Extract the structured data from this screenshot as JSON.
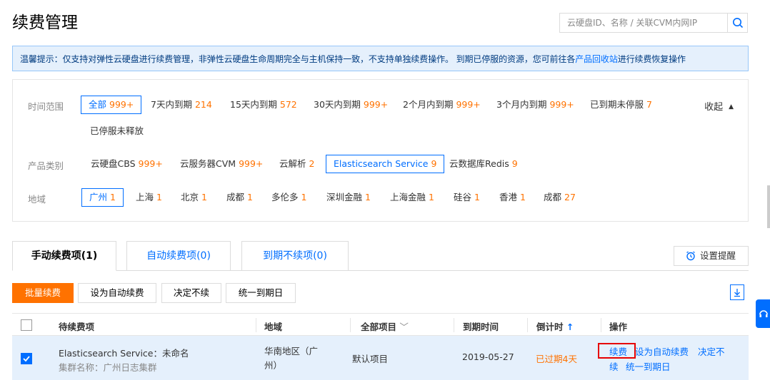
{
  "header": {
    "title": "续费管理",
    "search_placeholder": "云硬盘ID、名称 / 关联CVM内网IP"
  },
  "tip": {
    "text_before": "温馨提示：仅支持对弹性云硬盘进行续费管理，非弹性云硬盘生命周期完全与主机保持一致，不支持单独续费操作。 到期已停服的资源，您可前往各",
    "link": "产品回收站",
    "text_after": "进行续费恢复操作"
  },
  "filters": {
    "time": {
      "label": "时间范围",
      "items": [
        {
          "name": "全部",
          "count": "999+",
          "selected": true
        },
        {
          "name": "7天内到期",
          "count": "214"
        },
        {
          "name": "15天内到期",
          "count": "572"
        },
        {
          "name": "30天内到期",
          "count": "999+"
        },
        {
          "name": "2个月内到期",
          "count": "999+"
        },
        {
          "name": "3个月内到期",
          "count": "999+"
        },
        {
          "name": "已到期未停服",
          "count": "7"
        },
        {
          "name": "已停服未释放",
          "count": ""
        }
      ]
    },
    "collapse_label": "收起",
    "product": {
      "label": "产品类别",
      "items": [
        {
          "name": "云硬盘CBS",
          "count": "999+"
        },
        {
          "name": "云服务器CVM",
          "count": "999+"
        },
        {
          "name": "云解析",
          "count": "2"
        },
        {
          "name": "Elasticsearch Service",
          "count": "9",
          "selected": true
        },
        {
          "name": "云数据库Redis",
          "count": "9"
        }
      ]
    },
    "region": {
      "label": "地域",
      "items": [
        {
          "name": "广州",
          "count": "1",
          "selected": true
        },
        {
          "name": "上海",
          "count": "1"
        },
        {
          "name": "北京",
          "count": "1"
        },
        {
          "name": "成都",
          "count": "1"
        },
        {
          "name": "多伦多",
          "count": "1"
        },
        {
          "name": "深圳金融",
          "count": "1"
        },
        {
          "name": "上海金融",
          "count": "1"
        },
        {
          "name": "硅谷",
          "count": "1"
        },
        {
          "name": "香港",
          "count": "1"
        },
        {
          "name": "成都",
          "count": "27"
        }
      ]
    }
  },
  "tabs": [
    {
      "label": "手动续费项(1)",
      "active": true
    },
    {
      "label": "自动续费项(0)"
    },
    {
      "label": "到期不续项(0)"
    }
  ],
  "remind_label": "设置提醒",
  "actions": {
    "batch_renew": "批量续费",
    "set_auto": "设为自动续费",
    "no_renew": "决定不续",
    "unify_date": "统一到期日"
  },
  "table": {
    "columns": {
      "item": "待续费项",
      "region": "地域",
      "project": "全部项目",
      "expire": "到期时间",
      "countdown": "倒计时",
      "ops": "操作"
    },
    "rows": [
      {
        "name": "Elasticsearch Service：未命名",
        "cluster": "集群名称：广州日志集群",
        "region_line1": "华南地区（广",
        "region_line2": "州）",
        "project": "默认项目",
        "expire": "2019-05-27",
        "countdown": "已过期4天",
        "op_renew": "续费",
        "op_auto": "设为自动续费",
        "op_no_renew_1": "决定不",
        "op_no_renew_2": "续",
        "op_unify": "统一到期日"
      }
    ]
  },
  "colors": {
    "primary": "#006eff",
    "accent": "#ff7200",
    "highlight": "#e60000"
  }
}
